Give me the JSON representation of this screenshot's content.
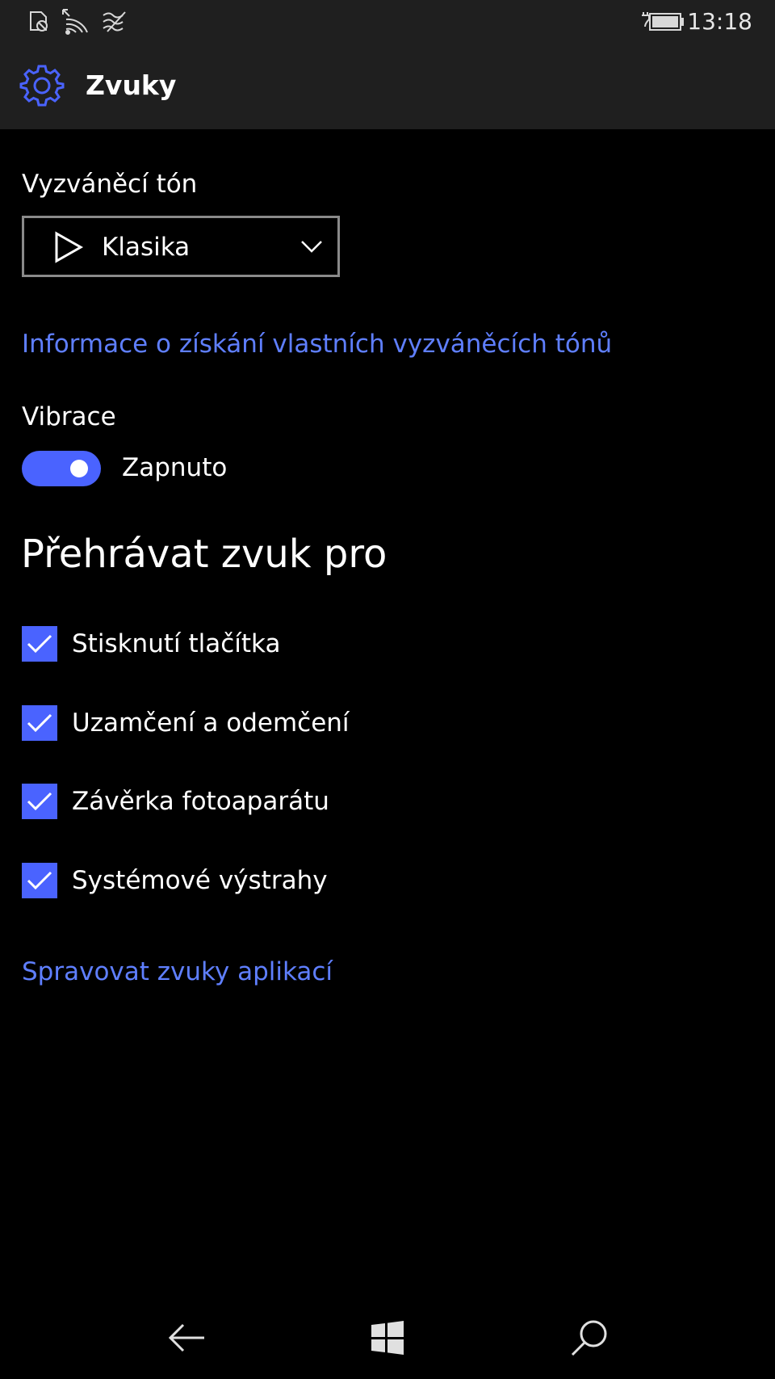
{
  "status_bar": {
    "time": "13:18",
    "icons": [
      "sim-off-icon",
      "wifi-icon",
      "cellular-off-icon",
      "battery-charging-icon"
    ]
  },
  "header": {
    "icon": "gear-icon",
    "title": "Zvuky"
  },
  "ringtone": {
    "label": "Vyzváněcí tón",
    "selected": "Klasika",
    "play_icon": "play-icon",
    "dropdown_icon": "chevron-down-icon"
  },
  "ringtone_info_link": "Informace o získání vlastních vyzváněcích tónů",
  "vibration": {
    "label": "Vibrace",
    "toggle_state": "Zapnuto",
    "on": true
  },
  "play_sound_section": {
    "heading": "Přehrávat zvuk pro",
    "items": [
      {
        "label": "Stisknutí tlačítka",
        "checked": true
      },
      {
        "label": "Uzamčení a odemčení",
        "checked": true
      },
      {
        "label": "Závěrka fotoaparátu",
        "checked": true
      },
      {
        "label": "Systémové výstrahy",
        "checked": true
      }
    ]
  },
  "app_sounds_link": "Spravovat zvuky aplikací",
  "nav": {
    "back_icon": "back-arrow-icon",
    "home_icon": "windows-logo-icon",
    "search_icon": "search-icon"
  },
  "colors": {
    "accent": "#4a63ff",
    "link": "#5f7fff",
    "background": "#000000",
    "header_background": "#1f1f1f"
  }
}
